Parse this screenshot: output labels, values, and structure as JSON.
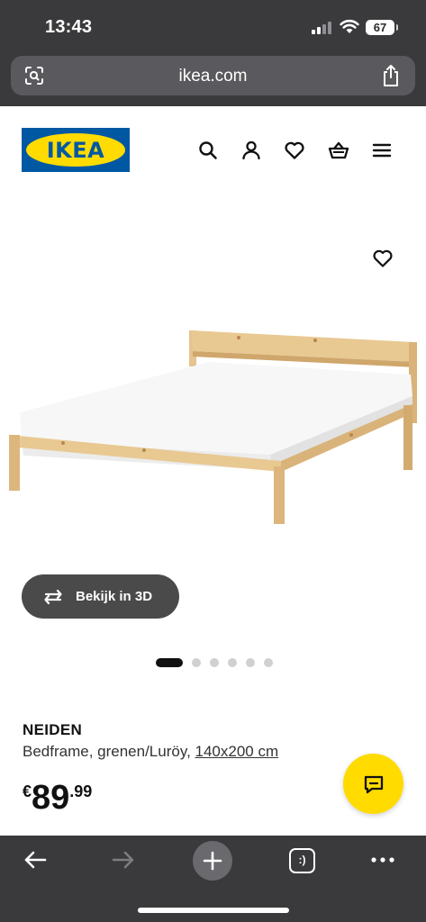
{
  "status_bar": {
    "time": "13:43",
    "battery": "67"
  },
  "browser": {
    "url": "ikea.com",
    "left_icon": "visual-search-icon",
    "right_icon": "share-icon"
  },
  "header": {
    "logo_text": "IKEA",
    "icons": [
      "search-icon",
      "account-icon",
      "favourites-icon",
      "basket-icon",
      "menu-icon"
    ]
  },
  "gallery": {
    "view_3d_label": "Bekijk in 3D",
    "slide_count": 6,
    "active_slide": 1
  },
  "product": {
    "name": "NEIDEN",
    "description": "Bedframe, grenen/Luröy, ",
    "size_link": "140x200 cm",
    "price": {
      "currency": "€",
      "integer": "89",
      "decimal": ".99"
    }
  },
  "toolbar": {
    "tabs_label": ":)"
  },
  "colors": {
    "ikea_blue": "#0058a3",
    "ikea_yellow": "#ffdb00",
    "browser_chrome": "#3a3a3c"
  }
}
